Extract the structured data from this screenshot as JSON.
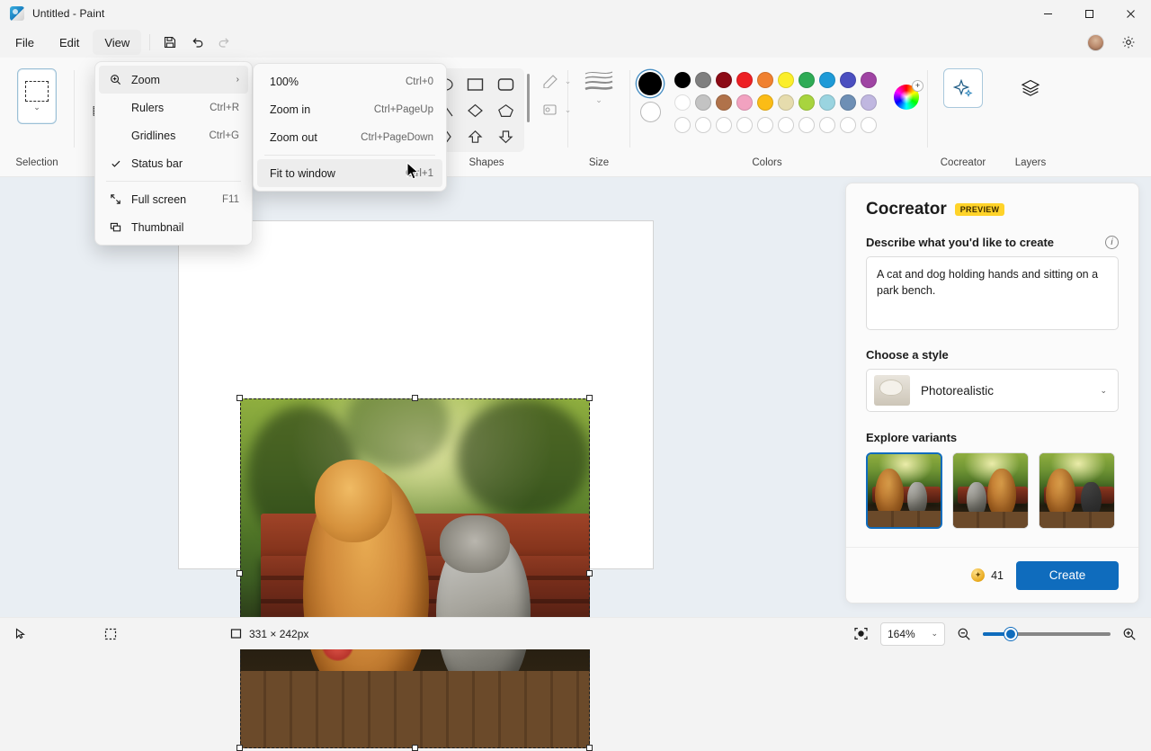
{
  "window": {
    "title": "Untitled - Paint",
    "app_icon": "paint-icon",
    "controls": {
      "minimize": "–",
      "maximize": "□",
      "close": "✕"
    }
  },
  "menubar": {
    "items": [
      {
        "label": "File",
        "active": false
      },
      {
        "label": "Edit",
        "active": false
      },
      {
        "label": "View",
        "active": true
      }
    ],
    "buttons": [
      {
        "name": "save-button",
        "icon": "floppy-disk-icon",
        "enabled": true
      },
      {
        "name": "undo-button",
        "icon": "undo-arrow-icon",
        "enabled": true
      },
      {
        "name": "redo-button",
        "icon": "redo-arrow-icon",
        "enabled": false
      }
    ],
    "right": [
      {
        "name": "account-avatar",
        "icon": "avatar-icon"
      },
      {
        "name": "settings-button",
        "icon": "gear-icon"
      }
    ]
  },
  "view_menu": {
    "items": [
      {
        "label": "Zoom",
        "shortcut": "",
        "icon": "zoom-magnifier-icon",
        "submenu": true,
        "checked": false,
        "highlighted": true
      },
      {
        "label": "Rulers",
        "shortcut": "Ctrl+R",
        "icon": "",
        "submenu": false,
        "checked": false,
        "highlighted": false
      },
      {
        "label": "Gridlines",
        "shortcut": "Ctrl+G",
        "icon": "",
        "submenu": false,
        "checked": false,
        "highlighted": false
      },
      {
        "label": "Status bar",
        "shortcut": "",
        "icon": "check-icon",
        "submenu": false,
        "checked": true,
        "highlighted": false
      },
      {
        "label": "Full screen",
        "shortcut": "F11",
        "icon": "expand-arrows-icon",
        "submenu": false,
        "checked": false,
        "highlighted": false
      },
      {
        "label": "Thumbnail",
        "shortcut": "",
        "icon": "thumbnail-icon",
        "submenu": false,
        "checked": false,
        "highlighted": false
      }
    ],
    "separator_after_index": 3
  },
  "zoom_menu": {
    "items": [
      {
        "label": "100%",
        "shortcut": "Ctrl+0",
        "highlighted": false
      },
      {
        "label": "Zoom in",
        "shortcut": "Ctrl+PageUp",
        "highlighted": false
      },
      {
        "label": "Zoom out",
        "shortcut": "Ctrl+PageDown",
        "highlighted": false
      },
      {
        "label": "Fit to window",
        "shortcut": "Ctrl+1",
        "highlighted": true
      }
    ],
    "separator_after_index": 2
  },
  "ribbon": {
    "groups": [
      {
        "name": "selection",
        "label": "Selection"
      },
      {
        "name": "shapes",
        "label": "Shapes"
      },
      {
        "name": "size",
        "label": "Size"
      },
      {
        "name": "colors",
        "label": "Colors"
      },
      {
        "name": "cocreator",
        "label": "Cocreator"
      },
      {
        "name": "layers",
        "label": "Layers"
      }
    ],
    "colors": {
      "primary": "#000000",
      "secondary": "#ffffff",
      "row1": [
        "#000000",
        "#7f7f7f",
        "#8c0b16",
        "#ed2024",
        "#f08130",
        "#fbee2a",
        "#2eab55",
        "#1e9ad7",
        "#4b4fc0",
        "#9f44a3"
      ],
      "row2": [
        "#ffffff",
        "#c3c3c3",
        "#b0724a",
        "#f2a2c0",
        "#fbbc16",
        "#e6dcad",
        "#a8d43e",
        "#9ad4e0",
        "#6e8fb5",
        "#c0b7e0"
      ],
      "row3": [
        "#ffffff",
        "#ffffff",
        "#ffffff",
        "#ffffff",
        "#ffffff",
        "#ffffff",
        "#ffffff",
        "#ffffff",
        "#ffffff",
        "#ffffff"
      ],
      "wheel": "color-wheel-icon"
    },
    "shapes": [
      "oval",
      "rectangle",
      "rounded-rectangle",
      "triangle",
      "diamond",
      "pentagon",
      "hexagon",
      "arrow-up",
      "arrow-down"
    ]
  },
  "cocreator": {
    "title": "Cocreator",
    "badge": "PREVIEW",
    "describe_label": "Describe what you'd like to create",
    "info_icon": "info-icon",
    "prompt_value": "A cat and dog holding hands and sitting on a park bench.",
    "prompt_placeholder": "Describe what you'd like to create",
    "style_label": "Choose a style",
    "style_selected": "Photorealistic",
    "variants_label": "Explore variants",
    "variants": [
      {
        "name": "variant-1",
        "selected": true
      },
      {
        "name": "variant-2",
        "selected": false
      },
      {
        "name": "variant-3",
        "selected": false
      }
    ],
    "credits": "41",
    "create_label": "Create"
  },
  "statusbar": {
    "cursor_icon": "cursor-arrow-icon",
    "selection_icon": "selection-dashed-icon",
    "size_icon": "image-size-icon",
    "image_size": "331 × 242px",
    "fit_icon": "fit-to-screen-icon",
    "zoom_value": "164%",
    "zoom_out_icon": "zoom-out-icon",
    "zoom_in_icon": "zoom-in-icon"
  },
  "canvas": {
    "selection_label": "selected-image-region",
    "accent": "#0f6cbd"
  }
}
